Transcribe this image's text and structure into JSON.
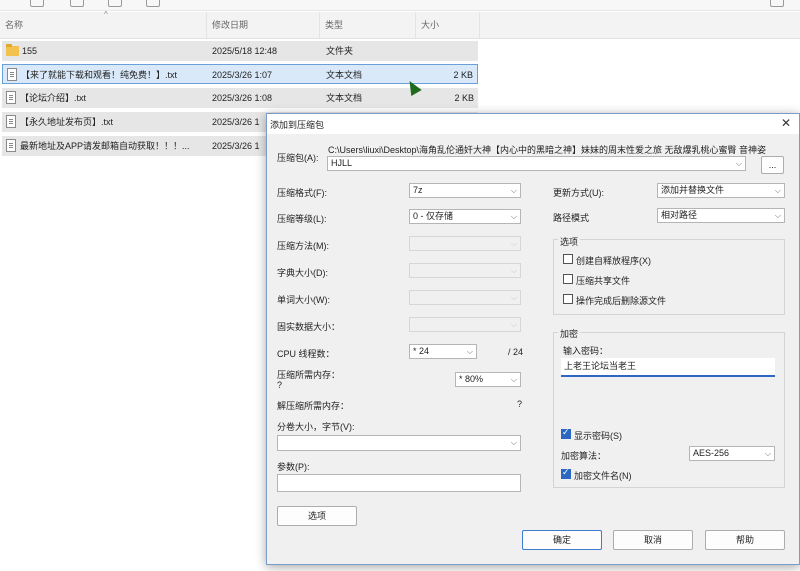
{
  "explorer": {
    "columns": [
      "名称",
      "修改日期",
      "类型",
      "大小"
    ],
    "files": [
      {
        "name": "155",
        "date": "2025/5/18 12:48",
        "type": "文件夹",
        "size": ""
      },
      {
        "name": "【来了就能下载和观看！纯免费！】.txt",
        "date": "2025/3/26 1:07",
        "type": "文本文档",
        "size": "2 KB"
      },
      {
        "name": "【论坛介绍】.txt",
        "date": "2025/3/26 1:08",
        "type": "文本文档",
        "size": "2 KB"
      },
      {
        "name": "【永久地址发布页】.txt",
        "date": "2025/3/26 1",
        "type": "",
        "size": ""
      },
      {
        "name": "最新地址及APP请发邮箱自动获取！！！...",
        "date": "2025/3/26 1",
        "type": "",
        "size": ""
      }
    ]
  },
  "dialog": {
    "title": "添加到压缩包",
    "close": "✕",
    "archive_label": "压缩包(A):",
    "archive_path": "C:\\Users\\liuxi\\Desktop\\海角乱伦通奸大神【内心中的黑暗之神】妹妹的周末性爱之旅 无敌爆乳桃心蜜臀 音神姿",
    "archive_name": "HJLL",
    "browse": "...",
    "left": {
      "format_label": "压缩格式(F):",
      "format": "7z",
      "level_label": "压缩等级(L):",
      "level": "0 - 仅存储",
      "method_label": "压缩方法(M):",
      "dict_label": "字典大小(D):",
      "word_label": "单词大小(W):",
      "solid_label": "固实数据大小：",
      "cpu_label": "CPU 线程数：",
      "cpu": "* 24",
      "cpu_total": "/ 24",
      "mem_label": "压缩所需内存：",
      "mem_q": "?",
      "mem": "* 80%",
      "decomp_label": "解压缩所需内存：",
      "decomp_q": "?",
      "split_label": "分卷大小，字节(V):",
      "params_label": "参数(P):",
      "options_btn": "选项"
    },
    "right": {
      "update_label": "更新方式(U):",
      "update": "添加并替换文件",
      "path_label": "路径模式",
      "path": "相对路径",
      "options_group": "选项",
      "opt_sfx": "创建自释放程序(X)",
      "opt_shared": "压缩共享文件",
      "opt_delete": "操作完成后删除源文件",
      "enc_group": "加密",
      "pwd_label": "输入密码：",
      "pwd_value": "上老王论坛当老王",
      "show_pwd": "显示密码(S)",
      "enc_method_label": "加密算法：",
      "enc_method": "AES-256",
      "enc_names": "加密文件名(N)"
    },
    "buttons": {
      "ok": "确定",
      "cancel": "取消",
      "help": "帮助"
    }
  },
  "colors": {
    "accent": "#2d67c3",
    "selection": "#d9e9fa",
    "folder": "#f2c14e"
  }
}
